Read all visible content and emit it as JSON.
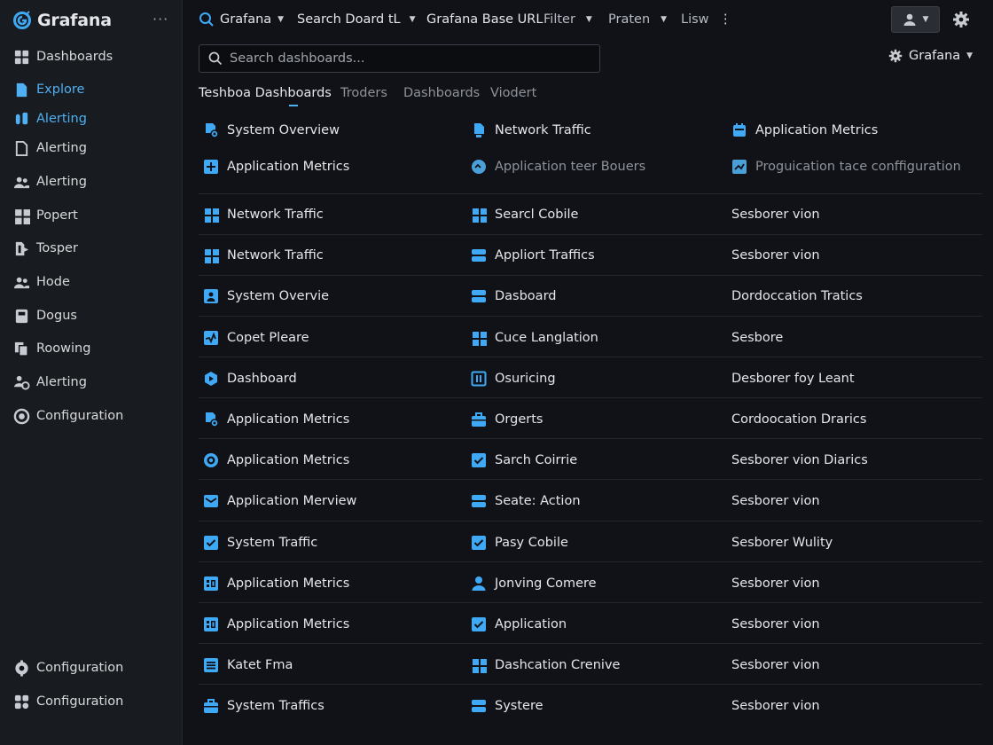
{
  "sidebar": {
    "brand": "Grafana",
    "more": "···",
    "items": [
      {
        "label": "Dashboards",
        "icon": "dashboards-icon",
        "active": false
      },
      {
        "label": "Explore",
        "icon": "document-icon",
        "active": true
      },
      {
        "label": "Alerting",
        "icon": "alerting-bell-icon",
        "active": true
      },
      {
        "label": "Alerting",
        "icon": "file-icon",
        "active": false
      },
      {
        "label": "Alerting",
        "icon": "users-icon",
        "active": false
      },
      {
        "label": "Popert",
        "icon": "grid-icon",
        "active": false
      },
      {
        "label": "Tosper",
        "icon": "file-arrow-icon",
        "active": false
      },
      {
        "label": "Hode",
        "icon": "users-icon",
        "active": false
      },
      {
        "label": "Dogus",
        "icon": "book-icon",
        "active": false
      },
      {
        "label": "Roowing",
        "icon": "copy-icon",
        "active": false
      },
      {
        "label": "Alerting",
        "icon": "people-gear-icon",
        "active": false
      },
      {
        "label": "Configuration",
        "icon": "cog-circle-icon",
        "active": false
      }
    ],
    "bottom": [
      {
        "label": "Configuration",
        "icon": "cog-people-icon"
      },
      {
        "label": "Configuration",
        "icon": "plugin-icon"
      }
    ]
  },
  "topbar": {
    "grafana": "Grafana",
    "search_board": "Search Doard  tL",
    "base_url": "Grafana Base URL",
    "filter": "Filter",
    "praten": "Praten",
    "lisw": "Lisw",
    "kebab": "⋮"
  },
  "search": {
    "placeholder": "Search dashboards..."
  },
  "org": {
    "label": "Grafana"
  },
  "tabs": [
    "Teshboa Dashboards",
    "Troders",
    "Dashboards",
    "Viodert"
  ],
  "featured": [
    [
      {
        "label": "System Overview",
        "icon": "doc-gear-icon"
      },
      {
        "label": "Network Traffic",
        "icon": "doc-icon"
      },
      {
        "label": "Application Metrics",
        "icon": "calendar-icon"
      }
    ],
    [
      {
        "label": "Application Metrics",
        "icon": "plus-square-icon"
      },
      {
        "label": "Application teer Bouers",
        "icon": "circle-icon",
        "dim": true
      },
      {
        "label": "Proguication tace conffiguration",
        "icon": "chart-square-icon",
        "dim": true
      }
    ]
  ],
  "rows": [
    [
      {
        "label": "Network Traffic",
        "icon": "grid-icon"
      },
      {
        "label": "Searcl Cobile",
        "icon": "grid-icon"
      },
      {
        "label": "Sesborer vion"
      }
    ],
    [
      {
        "label": "Network Traffic",
        "icon": "grid-icon"
      },
      {
        "label": "Appliort Traffics",
        "icon": "panel-icon"
      },
      {
        "label": "Sesborer vion"
      }
    ],
    [
      {
        "label": "System Overvie",
        "icon": "user-square-icon"
      },
      {
        "label": "Dasboard",
        "icon": "panel-icon"
      },
      {
        "label": "Dordoccation Tratics"
      }
    ],
    [
      {
        "label": "Copet Pleare",
        "icon": "pulse-icon"
      },
      {
        "label": "Cuce Langlation",
        "icon": "grid-icon"
      },
      {
        "label": "Sesbore"
      }
    ],
    [
      {
        "label": "Dashboard",
        "icon": "shield-play-icon"
      },
      {
        "label": "Osuricing",
        "icon": "frame-icon"
      },
      {
        "label": "Desborer foy Leant"
      }
    ],
    [
      {
        "label": "Application Metrics",
        "icon": "doc-gear-icon"
      },
      {
        "label": "Orgerts",
        "icon": "briefcase-icon"
      },
      {
        "label": "Cordoocation Drarics"
      }
    ],
    [
      {
        "label": "Application Metrics",
        "icon": "target-icon"
      },
      {
        "label": "Sarch Coirrie",
        "icon": "check-square-icon"
      },
      {
        "label": "Sesborer vion Diarics"
      }
    ],
    [
      {
        "label": "Application Merview",
        "icon": "mail-icon"
      },
      {
        "label": "Seate: Action",
        "icon": "panel-icon"
      },
      {
        "label": "Sesborer vion"
      }
    ],
    [
      {
        "label": "System Traffic",
        "icon": "check-square-icon"
      },
      {
        "label": "Pasy Cobile",
        "icon": "check-square-icon"
      },
      {
        "label": "Sesborer Wulity"
      }
    ],
    [
      {
        "label": "Application Metrics",
        "icon": "table-icon"
      },
      {
        "label": "Jonving Comere",
        "icon": "user-icon"
      },
      {
        "label": "Sesborer vion"
      }
    ],
    [
      {
        "label": "Application Metrics",
        "icon": "table-icon"
      },
      {
        "label": "Application",
        "icon": "check-square-icon"
      },
      {
        "label": "Sesborer vion"
      }
    ],
    [
      {
        "label": "Katet Fma",
        "icon": "list-icon"
      },
      {
        "label": "Dashcation Crenive",
        "icon": "grid-icon"
      },
      {
        "label": "Sesborer vion"
      }
    ],
    [
      {
        "label": "System Traffics",
        "icon": "briefcase-icon"
      },
      {
        "label": "Systere",
        "icon": "panel-icon"
      },
      {
        "label": "Sesborer vion"
      }
    ]
  ],
  "colors": {
    "accent": "#4fb0f3",
    "icon_blue": "#3fa9f5",
    "bg": "#111217",
    "sidebar": "#181b1f"
  }
}
